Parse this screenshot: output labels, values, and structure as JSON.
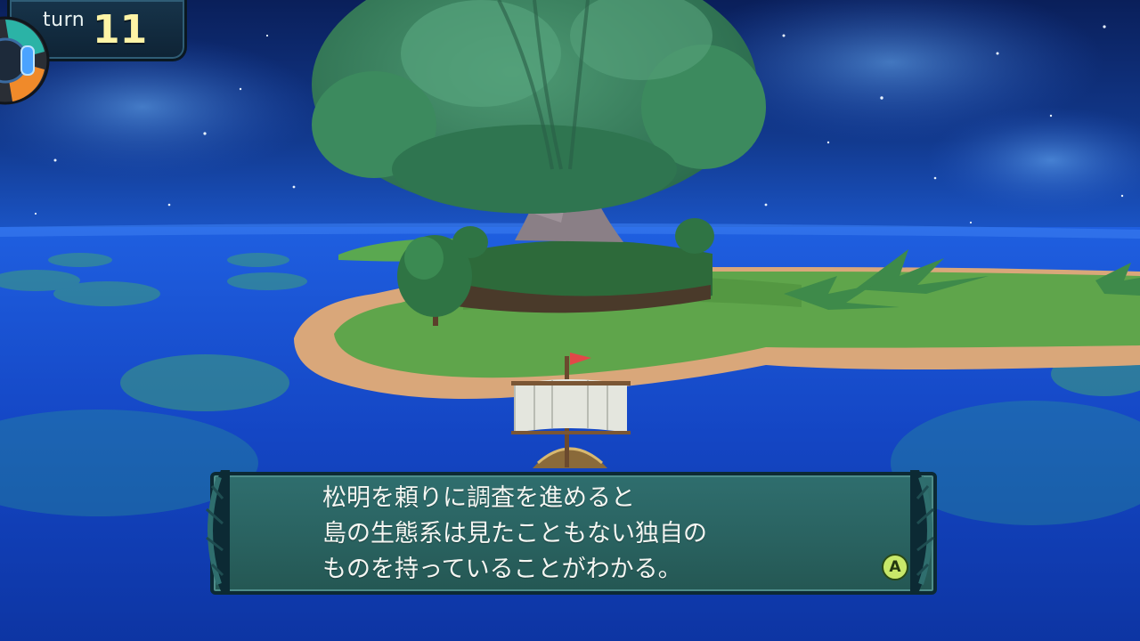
{
  "hud": {
    "turn_label": "turn",
    "turn_value": "11"
  },
  "dialog": {
    "lines": [
      "松明を頼りに調査を進めると",
      "島の生態系は見たこともない独自の",
      "ものを持っていることがわかる。"
    ],
    "advance_button": "A"
  },
  "scene": {
    "icons": [
      "compass-icon",
      "ship-flag-icon"
    ],
    "colors": {
      "sky": "#0b2466",
      "sea": "#1347c9",
      "grass": "#5a9a48",
      "tree": "#3f8a5a",
      "dialog": "#2f6e6e",
      "turn_value": "#fff4a6",
      "a_button": "#c8e86a"
    }
  }
}
